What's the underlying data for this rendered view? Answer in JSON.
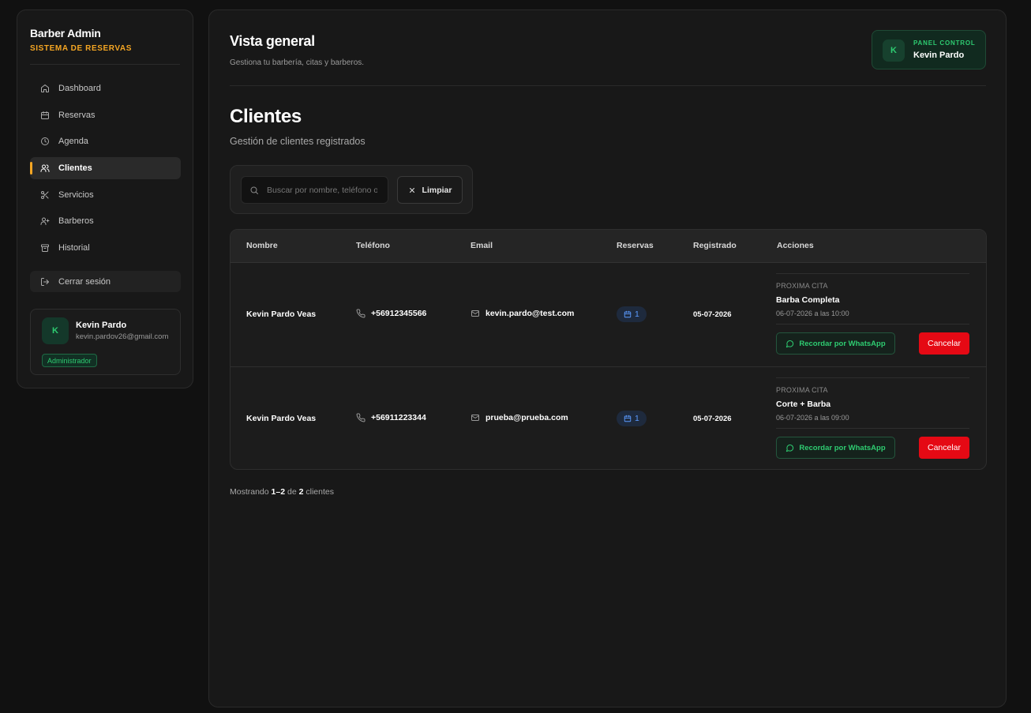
{
  "brand": {
    "title": "Barber Admin",
    "subtitle": "SISTEMA DE RESERVAS"
  },
  "sidebar": {
    "items": [
      {
        "label": "Dashboard",
        "icon": "home-icon"
      },
      {
        "label": "Reservas",
        "icon": "calendar-icon"
      },
      {
        "label": "Agenda",
        "icon": "clock-icon"
      },
      {
        "label": "Clientes",
        "icon": "users-icon",
        "active": true
      },
      {
        "label": "Servicios",
        "icon": "scissors-icon"
      },
      {
        "label": "Barberos",
        "icon": "user-plus-icon"
      },
      {
        "label": "Historial",
        "icon": "archive-icon"
      }
    ],
    "logout_label": "Cerrar sesión"
  },
  "user": {
    "initial": "K",
    "name": "Kevin Pardo",
    "email": "kevin.pardov26@gmail.com",
    "role": "Administrador"
  },
  "header": {
    "title": "Vista general",
    "subtitle": "Gestiona tu barbería, citas y barberos.",
    "panel_label": "PANEL CONTROL",
    "panel_name": "Kevin Pardo",
    "panel_initial": "K"
  },
  "section": {
    "title": "Clientes",
    "subtitle": "Gestión de clientes registrados"
  },
  "filters": {
    "search_placeholder": "Buscar por nombre, teléfono o email",
    "clear_label": "Limpiar"
  },
  "table": {
    "columns": [
      "Nombre",
      "Teléfono",
      "Email",
      "Reservas",
      "Registrado",
      "Acciones"
    ],
    "rows": [
      {
        "name": "Kevin Pardo Veas",
        "phone": "+56912345566",
        "email": "kevin.pardo@test.com",
        "reservas": "1",
        "registrado": "05-07-2026",
        "next_label": "PROXIMA CITA",
        "next_service": "Barba Completa",
        "next_date": "06-07-2026 a las 10:00",
        "whatsapp_label": "Recordar por WhatsApp",
        "cancel_label": "Cancelar"
      },
      {
        "name": "Kevin Pardo Veas",
        "phone": "+56911223344",
        "email": "prueba@prueba.com",
        "reservas": "1",
        "registrado": "05-07-2026",
        "next_label": "PROXIMA CITA",
        "next_service": "Corte + Barba",
        "next_date": "06-07-2026 a las 09:00",
        "whatsapp_label": "Recordar por WhatsApp",
        "cancel_label": "Cancelar"
      }
    ]
  },
  "footer": {
    "prefix": "Mostrando",
    "range": "1–2",
    "of": "de",
    "total": "2",
    "suffix": "clientes"
  },
  "colors": {
    "accent": "#f5a623",
    "success": "#2ecc71",
    "danger": "#e50914",
    "info": "#5b9bff"
  }
}
